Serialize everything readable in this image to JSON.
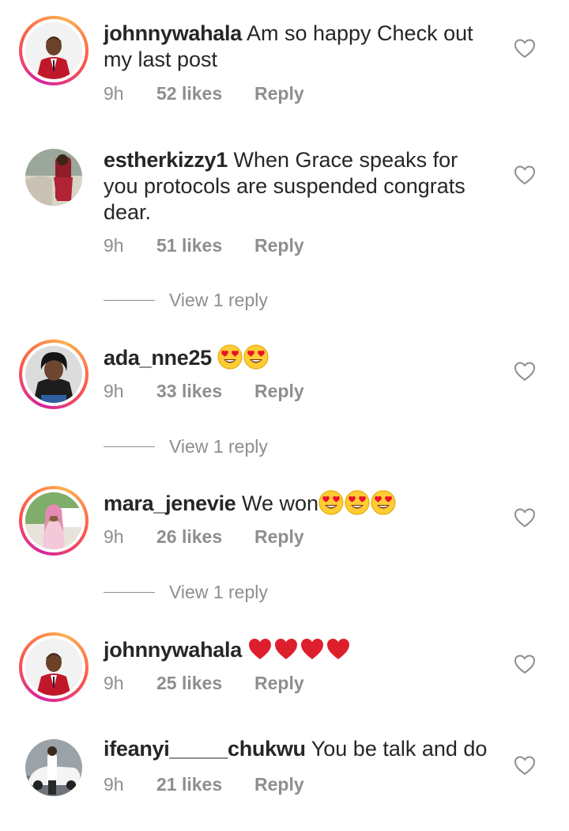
{
  "comments": [
    {
      "username": "johnnywahala",
      "text": " Am so happy Check out my last post",
      "emojis": [],
      "time": "9h",
      "likes": "52 likes",
      "reply": "Reply",
      "avatar": "avatar-man-red-suit",
      "story_ring": true
    },
    {
      "username": "estherkizzy1",
      "text": " When Grace speaks for you protocols are suspended congrats dear.",
      "emojis": [],
      "time": "9h",
      "likes": "51 likes",
      "reply": "Reply",
      "avatar": "avatar-woman-car",
      "story_ring": false,
      "view_replies": "View 1 reply"
    },
    {
      "username": "ada_nne25",
      "text": " ",
      "emojis": [
        "heart-eyes",
        "heart-eyes"
      ],
      "time": "9h",
      "likes": "33 likes",
      "reply": "Reply",
      "avatar": "avatar-woman-dark",
      "story_ring": true,
      "view_replies": "View 1 reply"
    },
    {
      "username": "mara_jenevie",
      "text": " We won",
      "emojis": [
        "heart-eyes",
        "heart-eyes",
        "heart-eyes"
      ],
      "time": "9h",
      "likes": "26 likes",
      "reply": "Reply",
      "avatar": "avatar-woman-pink-hair",
      "story_ring": true,
      "view_replies": "View 1 reply"
    },
    {
      "username": "johnnywahala",
      "text": " ",
      "emojis": [
        "red-heart",
        "red-heart",
        "red-heart",
        "red-heart"
      ],
      "time": "9h",
      "likes": "25 likes",
      "reply": "Reply",
      "avatar": "avatar-man-red-suit",
      "story_ring": true
    },
    {
      "username": "ifeanyi_____chukwu",
      "text": " You be talk and do",
      "emojis": [],
      "time": "9h",
      "likes": "21 likes",
      "reply": "Reply",
      "avatar": "avatar-man-white-car",
      "story_ring": false
    }
  ],
  "colors": {
    "text": "#262626",
    "meta": "#8e8e8e",
    "ring": "#d6249f"
  }
}
